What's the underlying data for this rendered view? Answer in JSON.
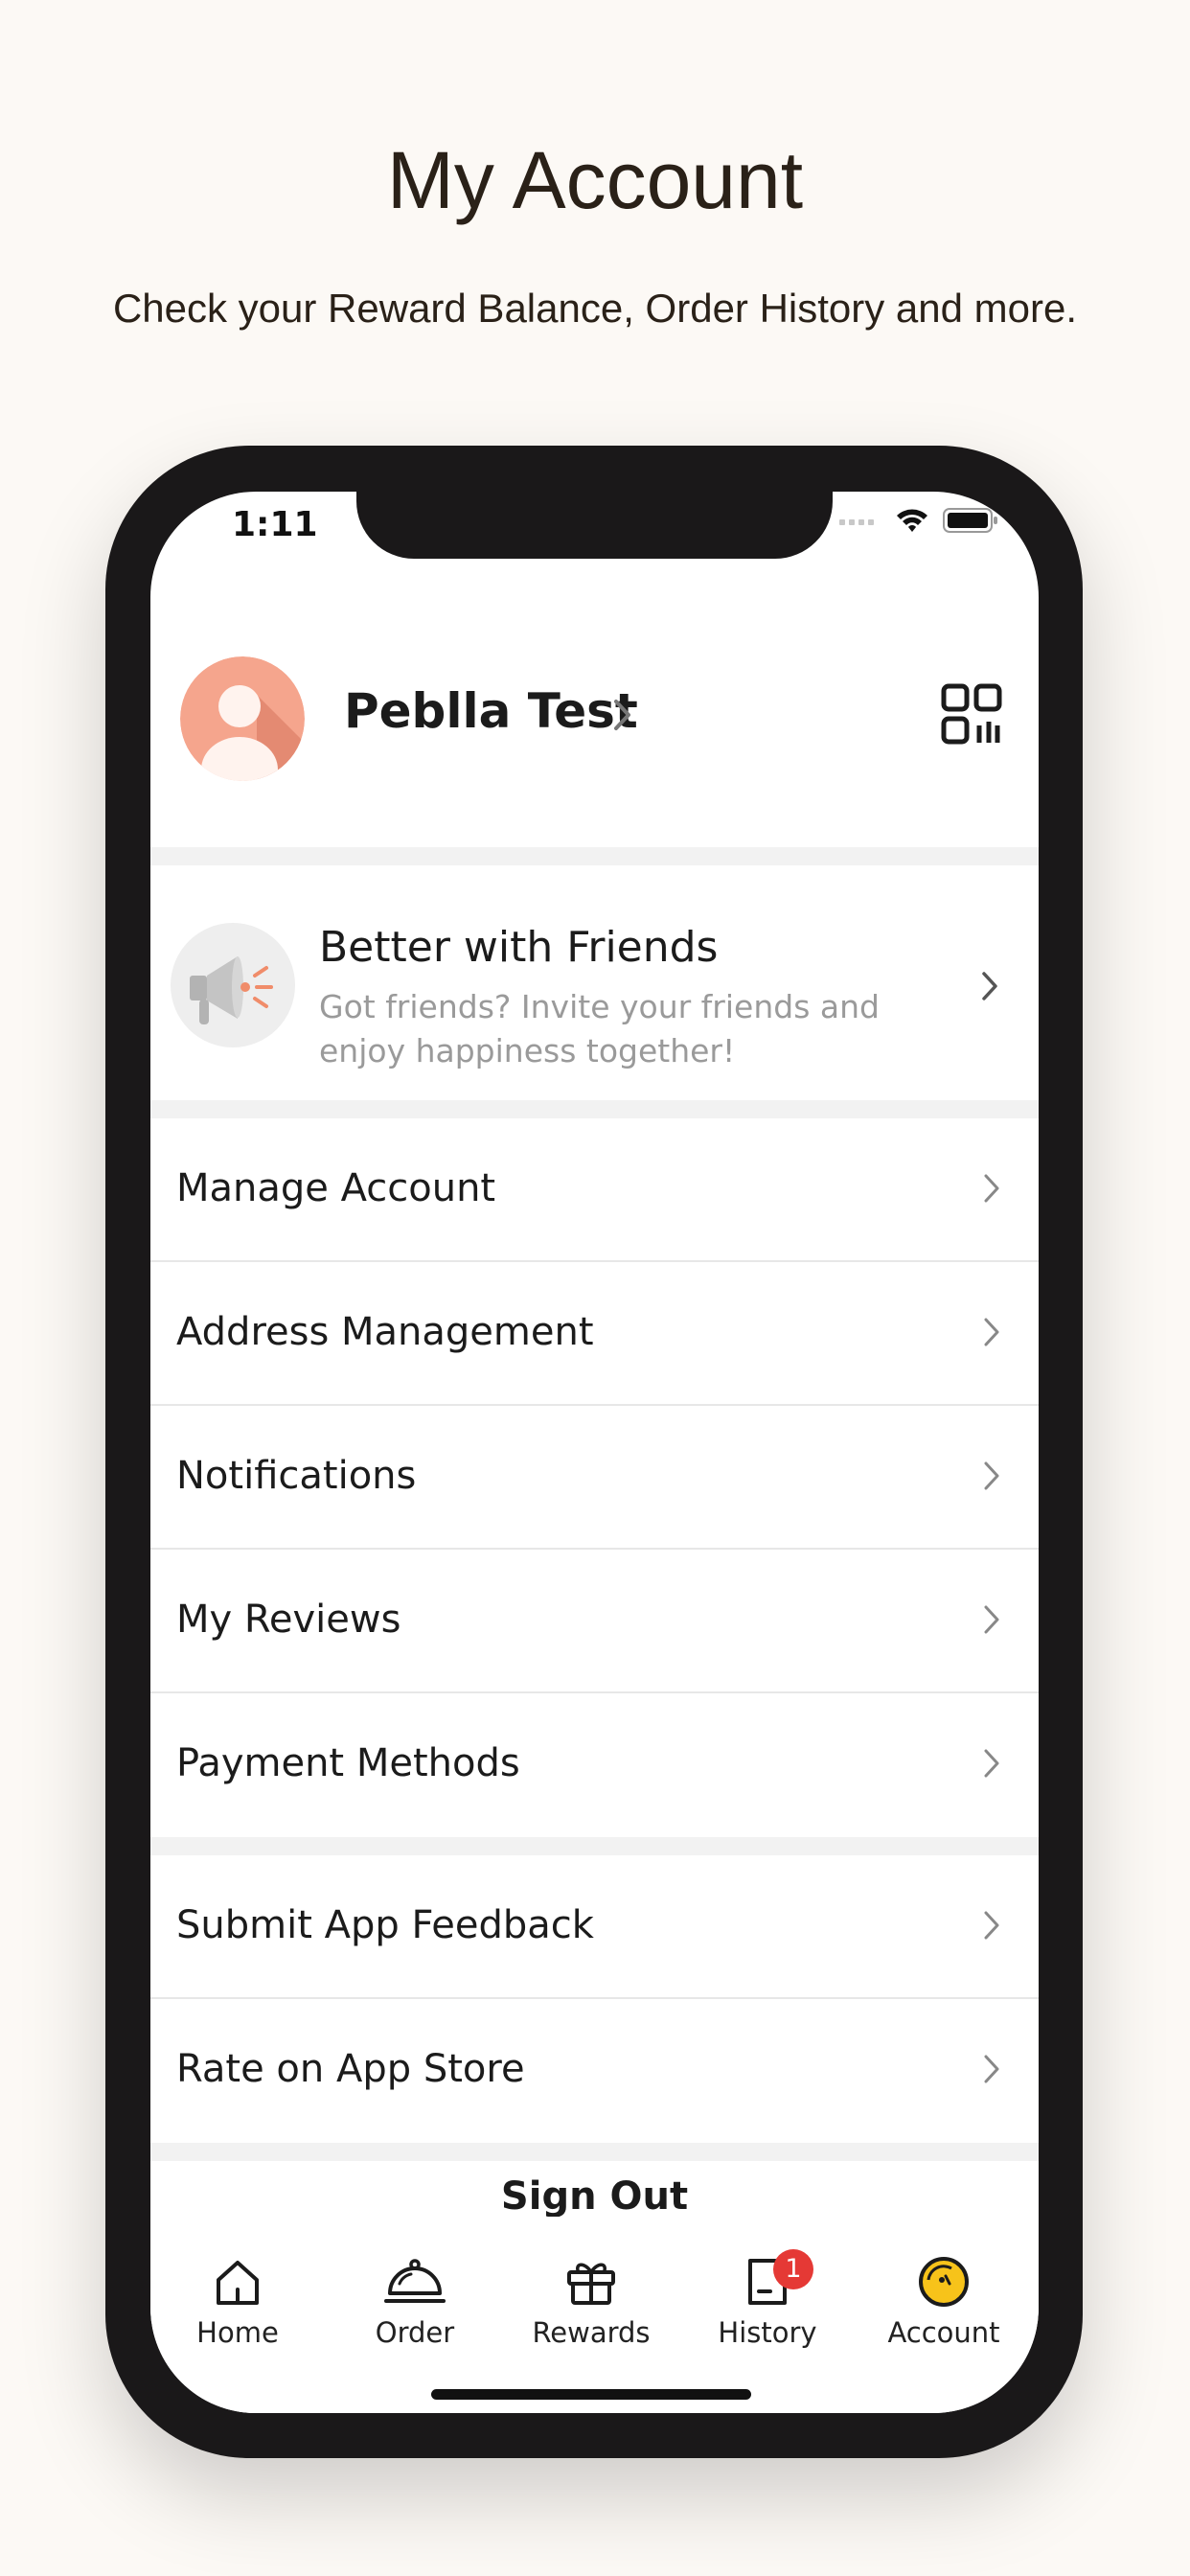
{
  "promo": {
    "title": "My Account",
    "subtitle": "Check your Reward Balance, Order History and more."
  },
  "status_bar": {
    "time": "1:11"
  },
  "profile": {
    "name": "Peblla Test"
  },
  "invite": {
    "title": "Better with Friends",
    "description": "Got friends? Invite your friends and enjoy happiness together!"
  },
  "menu_group_1": [
    {
      "label": "Manage Account"
    },
    {
      "label": "Address Management"
    },
    {
      "label": "Notifications"
    },
    {
      "label": "My Reviews"
    },
    {
      "label": "Payment Methods"
    }
  ],
  "menu_group_2": [
    {
      "label": "Submit App Feedback"
    },
    {
      "label": "Rate on App Store"
    }
  ],
  "sign_out": {
    "label": "Sign Out"
  },
  "tabs": [
    {
      "label": "Home",
      "icon": "home-icon"
    },
    {
      "label": "Order",
      "icon": "cloche-icon"
    },
    {
      "label": "Rewards",
      "icon": "gift-icon"
    },
    {
      "label": "History",
      "icon": "receipt-icon",
      "badge": "1"
    },
    {
      "label": "Account",
      "icon": "account-face-icon",
      "active": true
    }
  ],
  "colors": {
    "page_background": "#fcf9f5",
    "avatar": "#f5a58d",
    "badge": "#e53935",
    "account_accent": "#f7c31a"
  }
}
